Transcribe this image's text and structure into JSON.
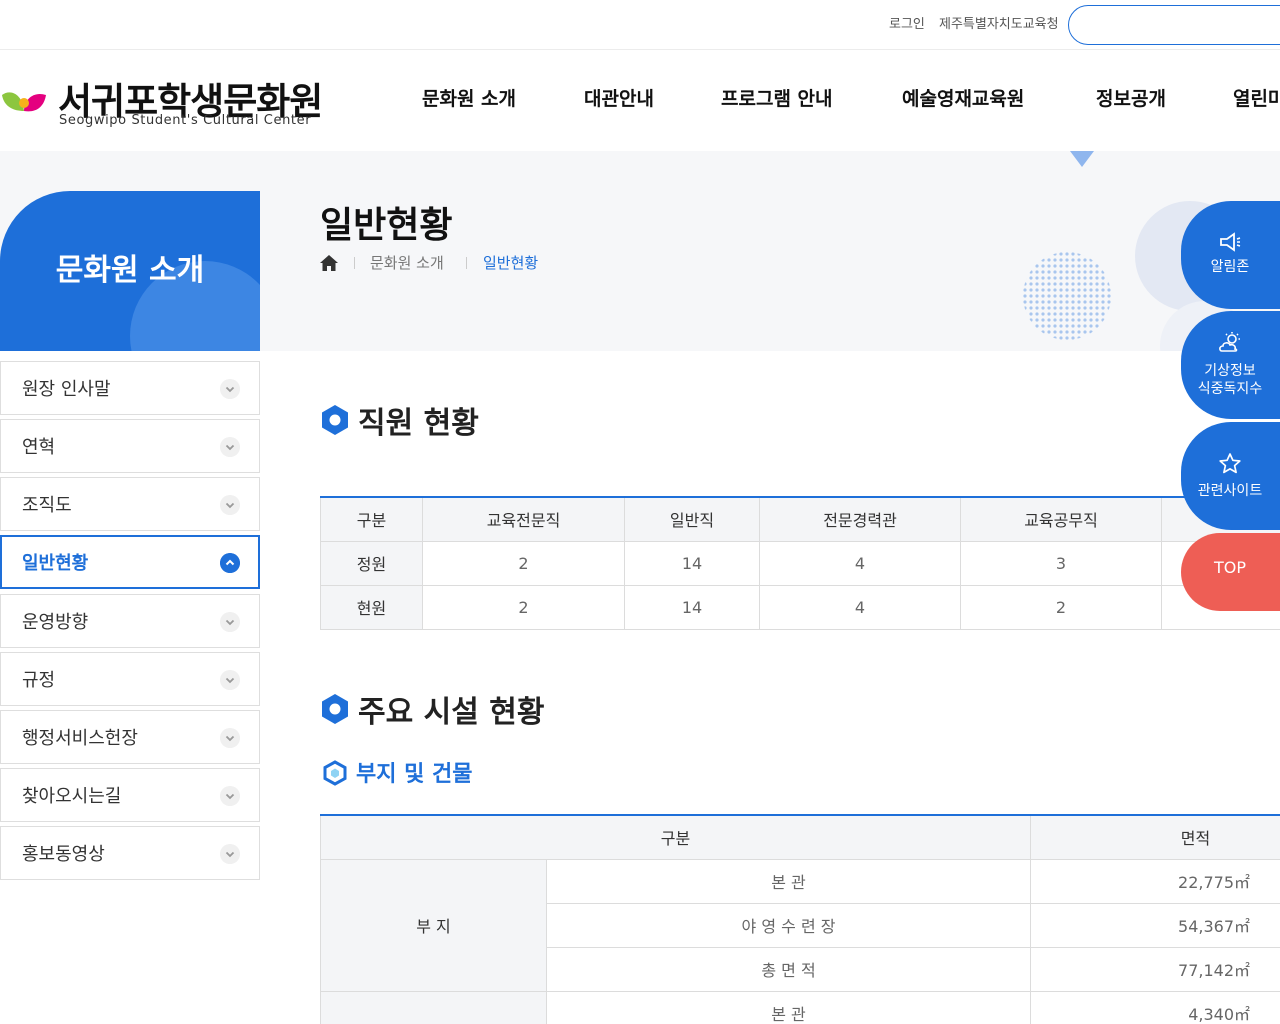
{
  "topbar": {
    "login": "로그인",
    "office": "제주특별자치도교육청"
  },
  "logo": {
    "title": "서귀포학생문화원",
    "subtitle": "Seogwipo Student's Cultural Center"
  },
  "gnb": [
    "문화원 소개",
    "대관안내",
    "프로그램 안내",
    "예술영재교육원",
    "정보공개",
    "열린마"
  ],
  "page": {
    "title": "일반현황",
    "breadcrumb": [
      "문화원 소개",
      "일반현황"
    ]
  },
  "lnb": {
    "title": "문화원 소개",
    "items": [
      "원장 인사말",
      "연혁",
      "조직도",
      "일반현황",
      "운영방향",
      "규정",
      "행정서비스헌장",
      "찾아오시는길",
      "홍보동영상"
    ],
    "active": "일반현황"
  },
  "staff": {
    "heading": "직원 현황",
    "columns": [
      "구분",
      "교육전문직",
      "일반직",
      "전문경력관",
      "교육공무직"
    ],
    "rows": [
      {
        "label": "정원",
        "values": [
          "2",
          "14",
          "4",
          "3"
        ]
      },
      {
        "label": "현원",
        "values": [
          "2",
          "14",
          "4",
          "2"
        ]
      }
    ]
  },
  "facility": {
    "heading": "주요 시설 현황",
    "subheading": "부지 및 건물",
    "columns": [
      "구분",
      "면적"
    ],
    "group": "부 지",
    "rows": [
      {
        "name": "본 관",
        "area": "22,775㎡"
      },
      {
        "name": "야 영 수 련 장",
        "area": "54,367㎡"
      },
      {
        "name": "총 면 적",
        "area": "77,142㎡"
      },
      {
        "name": "본 관",
        "area": "4,340㎡"
      }
    ]
  },
  "quick": {
    "notice": "알림존",
    "weather_1": "기상정보",
    "weather_2": "식중독지수",
    "sites": "관련사이트",
    "top": "TOP"
  },
  "colors": {
    "primary": "#1e6fd9",
    "top_button": "#ee5e55",
    "logo_green": "#8cc63f",
    "logo_pink": "#e4007f"
  },
  "icons": [
    "home-icon",
    "megaphone-icon",
    "weather-icon",
    "star-icon",
    "chevron-down-icon",
    "chevron-up-icon",
    "hexagon-bullet-icon"
  ]
}
